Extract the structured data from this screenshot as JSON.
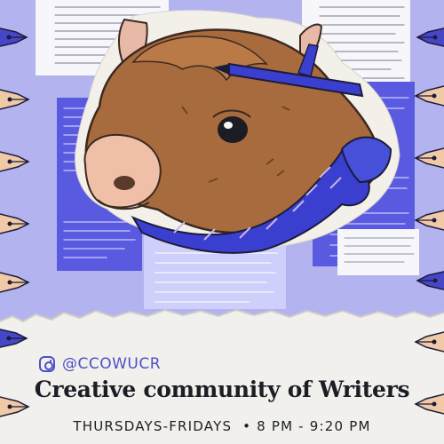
{
  "social": {
    "handle": "@CCOWUCR",
    "icon": "instagram-icon"
  },
  "headline": "Creative community of Writers",
  "schedule": "THURSDAYS-FRIDAYS  • 8 PM - 9:20 PM",
  "colors": {
    "background": "#b3b3f0",
    "accent": "#4f4fc8",
    "text": "#1d1d26",
    "ribbon": "#3b3fd0"
  }
}
